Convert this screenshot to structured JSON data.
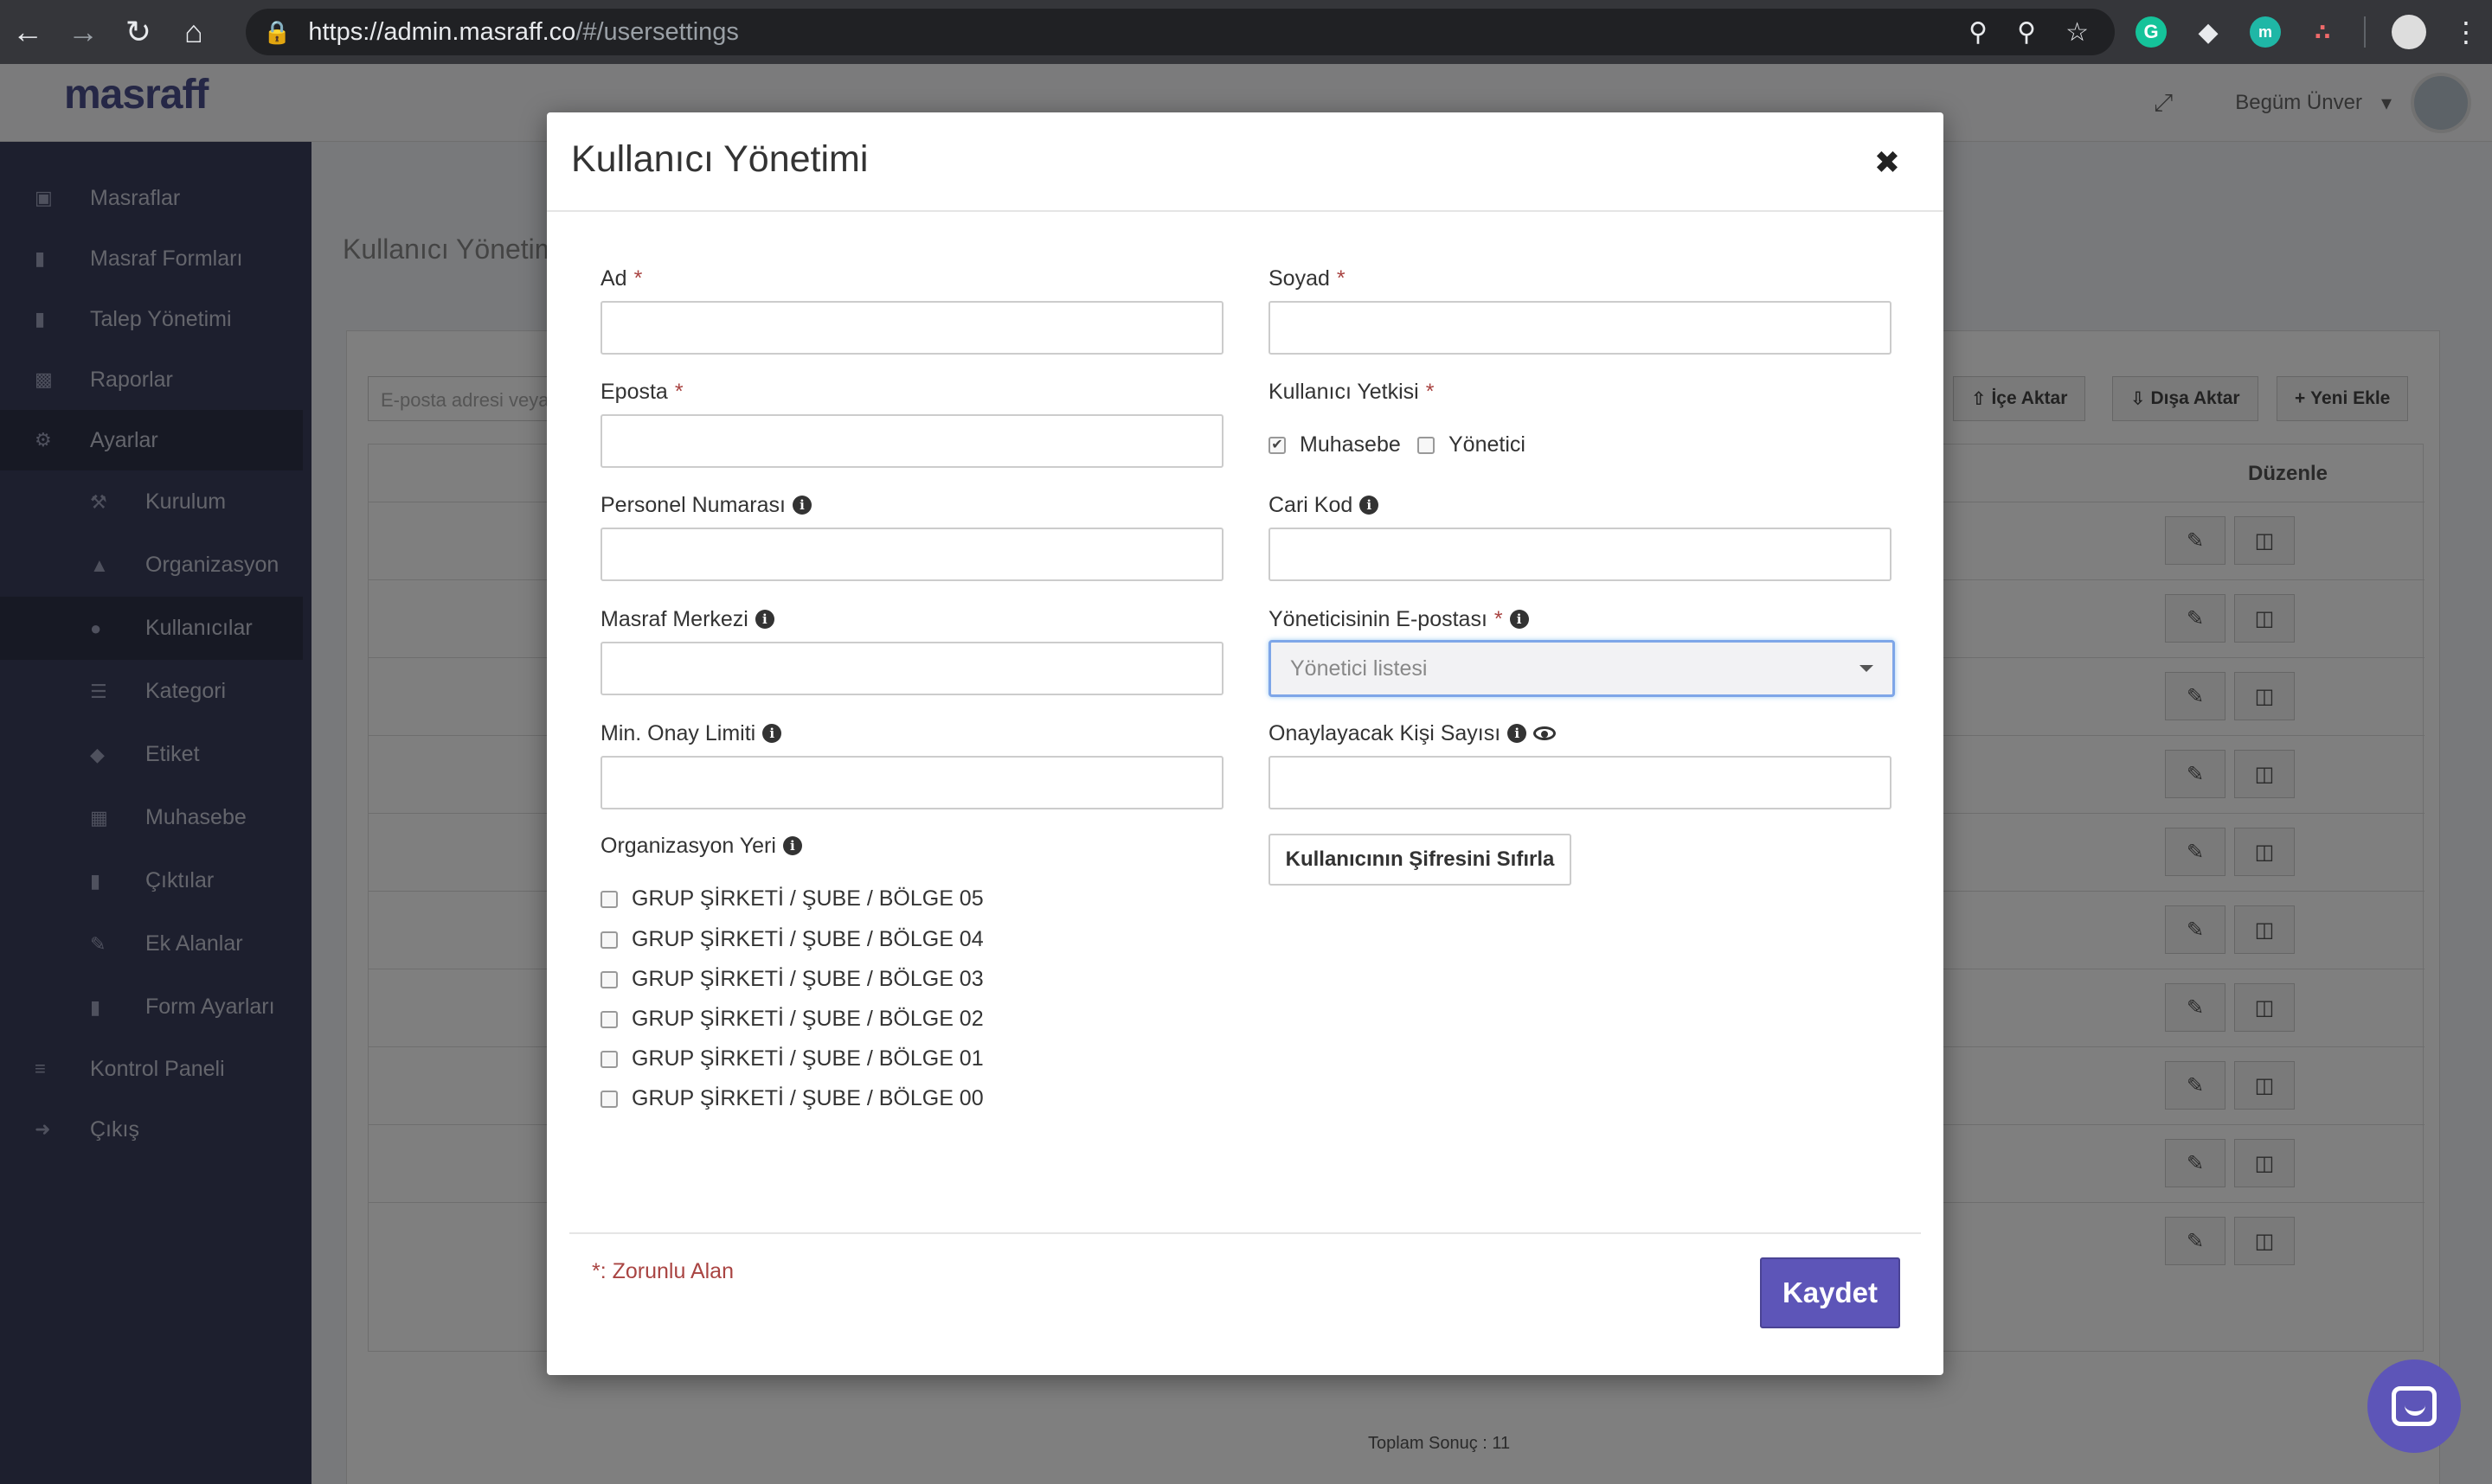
{
  "browser": {
    "url_domain": "https://admin.masraff.co",
    "url_path": "/#/usersettings"
  },
  "app": {
    "logo": "masraff",
    "user_name": "Begüm Ünver",
    "page_title": "Kullanıcı Yönetim",
    "sidebar": [
      {
        "label": "Masraflar",
        "icon": "money-icon"
      },
      {
        "label": "Masraf Formları",
        "icon": "file-icon"
      },
      {
        "label": "Talep Yönetimi",
        "icon": "file-icon"
      },
      {
        "label": "Raporlar",
        "icon": "bar-chart-icon"
      },
      {
        "label": "Ayarlar",
        "icon": "gear-icon"
      },
      {
        "label": "Kurulum",
        "icon": "wrench-icon"
      },
      {
        "label": "Organizasyon",
        "icon": "sitemap-icon"
      },
      {
        "label": "Kullanıcılar",
        "icon": "users-icon"
      },
      {
        "label": "Kategori",
        "icon": "list-icon"
      },
      {
        "label": "Etiket",
        "icon": "tag-icon"
      },
      {
        "label": "Muhasebe",
        "icon": "calculator-icon"
      },
      {
        "label": "Çıktılar",
        "icon": "file-icon"
      },
      {
        "label": "Ek Alanlar",
        "icon": "pencil-icon"
      },
      {
        "label": "Form Ayarları",
        "icon": "file-icon"
      },
      {
        "label": "Kontrol Paneli",
        "icon": "sliders-icon"
      },
      {
        "label": "Çıkış",
        "icon": "sign-out-icon"
      }
    ],
    "search_placeholder": "E-posta adresi veya",
    "buttons": {
      "import": "İçe Aktar",
      "export": "Dışa Aktar",
      "add_new": "Yeni Ekle"
    },
    "table_header_edit": "Düzenle",
    "total_label": "Toplam Sonuç : 11"
  },
  "modal": {
    "title": "Kullanıcı Yönetimi",
    "fields": {
      "first_name": {
        "label": "Ad",
        "value": ""
      },
      "last_name": {
        "label": "Soyad",
        "value": ""
      },
      "email": {
        "label": "Eposta",
        "value": ""
      },
      "permission": {
        "label": "Kullanıcı Yetkisi"
      },
      "personnel_no": {
        "label": "Personel Numarası",
        "value": ""
      },
      "account_code": {
        "label": "Cari Kod",
        "value": ""
      },
      "cost_center": {
        "label": "Masraf Merkezi",
        "value": ""
      },
      "manager_email": {
        "label": "Yöneticisinin E-postası",
        "placeholder": "Yönetici listesi"
      },
      "min_approval": {
        "label": "Min. Onay Limiti",
        "value": ""
      },
      "approver_count": {
        "label": "Onaylayacak Kişi Sayısı",
        "value": ""
      },
      "org_location": {
        "label": "Organizasyon Yeri"
      }
    },
    "permissions": [
      {
        "label": "Muhasebe",
        "checked": true
      },
      {
        "label": "Yönetici",
        "checked": false
      }
    ],
    "org_options": [
      "GRUP ŞİRKETİ / ŞUBE / BÖLGE 05",
      "GRUP ŞİRKETİ / ŞUBE / BÖLGE 04",
      "GRUP ŞİRKETİ / ŞUBE / BÖLGE 03",
      "GRUP ŞİRKETİ / ŞUBE / BÖLGE 02",
      "GRUP ŞİRKETİ / ŞUBE / BÖLGE 01",
      "GRUP ŞİRKETİ / ŞUBE / BÖLGE 00"
    ],
    "reset_password_label": "Kullanıcının Şifresini Sıfırla",
    "required_note": "*: Zorunlu Alan",
    "save_label": "Kaydet",
    "required_mark": "*"
  },
  "colors": {
    "accent": "#5d55b8",
    "required": "#a94442",
    "sidebar": "#3b3f5c"
  }
}
